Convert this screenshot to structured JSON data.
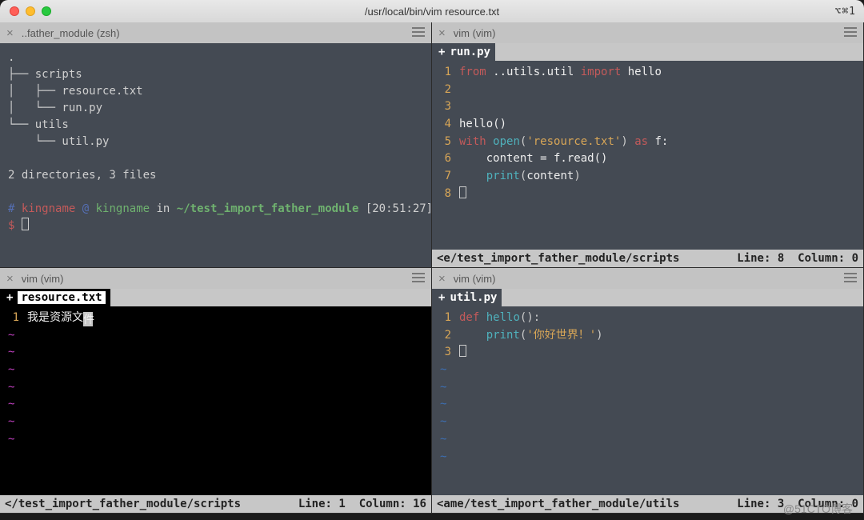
{
  "window": {
    "title": "/usr/local/bin/vim resource.txt",
    "shortcut_hint": "⌥⌘1"
  },
  "panes": {
    "top_left": {
      "tab_label": "..father_module (zsh)",
      "tree_lines": [
        ".",
        "├── scripts",
        "│   ├── resource.txt",
        "│   └── run.py",
        "└── utils",
        "    └── util.py"
      ],
      "summary": "2 directories, 3 files",
      "prompt": {
        "hash": "#",
        "user": "kingname",
        "at": "@",
        "host": "kingname",
        "in_word": "in",
        "path": "~/test_import_father_module",
        "time": "[20:51:27]",
        "dollar": "$"
      }
    },
    "top_right": {
      "tab_label": "vim (vim)",
      "file_plus": "+",
      "file_name": "run.py",
      "code": [
        {
          "n": "1",
          "t": [
            [
              "imp",
              "from"
            ],
            [
              "id",
              " ..utils.util "
            ],
            [
              "imp",
              "import"
            ],
            [
              "id",
              " hello"
            ]
          ]
        },
        {
          "n": "2",
          "t": []
        },
        {
          "n": "3",
          "t": []
        },
        {
          "n": "4",
          "t": [
            [
              "id",
              "hello()"
            ]
          ]
        },
        {
          "n": "5",
          "t": [
            [
              "kw",
              "with"
            ],
            [
              "id",
              " "
            ],
            [
              "fn",
              "open"
            ],
            [
              "op",
              "("
            ],
            [
              "str",
              "'resource.txt'"
            ],
            [
              "op",
              ") "
            ],
            [
              "kw",
              "as"
            ],
            [
              "id",
              " f:"
            ]
          ]
        },
        {
          "n": "6",
          "t": [
            [
              "id",
              "    content = f.read()"
            ]
          ]
        },
        {
          "n": "7",
          "t": [
            [
              "id",
              "    "
            ],
            [
              "fn",
              "print"
            ],
            [
              "op",
              "("
            ],
            [
              "id",
              "content"
            ],
            [
              "op",
              ")"
            ]
          ]
        },
        {
          "n": "8",
          "t": [
            [
              "id",
              ""
            ]
          ],
          "cursor": true
        }
      ],
      "status_path": "<e/test_import_father_module/scripts",
      "status_line": "Line: 8",
      "status_col": "Column: 0"
    },
    "bottom_left": {
      "tab_label": "vim (vim)",
      "file_plus": "+",
      "file_name": "resource.txt",
      "code": [
        {
          "n": "1",
          "text": "我是资源文",
          "tail": "件",
          "tail_hl": true
        }
      ],
      "tildes": 7,
      "status_path": "</test_import_father_module/scripts",
      "status_line": "Line: 1",
      "status_col": "Column: 16"
    },
    "bottom_right": {
      "tab_label": "vim (vim)",
      "file_plus": "+",
      "file_name": "util.py",
      "code": [
        {
          "n": "1",
          "t": [
            [
              "kw",
              "def"
            ],
            [
              "id",
              " "
            ],
            [
              "fn",
              "hello"
            ],
            [
              "op",
              "():"
            ]
          ]
        },
        {
          "n": "2",
          "t": [
            [
              "id",
              "    "
            ],
            [
              "fn",
              "print"
            ],
            [
              "op",
              "("
            ],
            [
              "str",
              "'你好世界！'"
            ],
            [
              "op",
              ")"
            ]
          ]
        },
        {
          "n": "3",
          "t": [
            [
              "id",
              ""
            ]
          ],
          "cursor": true
        }
      ],
      "tildes": 6,
      "status_path": "<ame/test_import_father_module/utils",
      "status_line": "Line: 3",
      "status_col": "Column: 0"
    }
  },
  "watermark": "@51CTO博客"
}
